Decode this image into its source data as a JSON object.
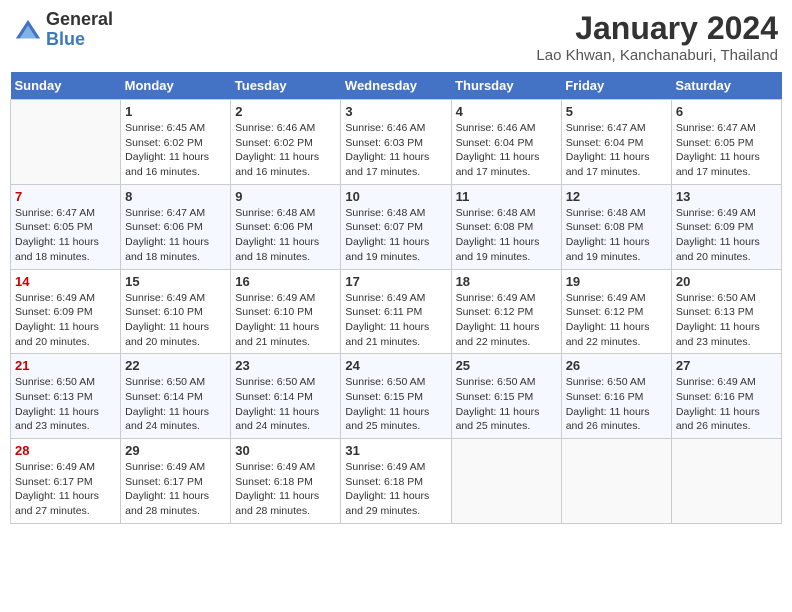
{
  "header": {
    "logo_general": "General",
    "logo_blue": "Blue",
    "month": "January 2024",
    "location": "Lao Khwan, Kanchanaburi, Thailand"
  },
  "days_of_week": [
    "Sunday",
    "Monday",
    "Tuesday",
    "Wednesday",
    "Thursday",
    "Friday",
    "Saturday"
  ],
  "weeks": [
    [
      {
        "day": "",
        "sunrise": "",
        "sunset": "",
        "daylight": ""
      },
      {
        "day": "1",
        "sunrise": "Sunrise: 6:45 AM",
        "sunset": "Sunset: 6:02 PM",
        "daylight": "Daylight: 11 hours and 16 minutes."
      },
      {
        "day": "2",
        "sunrise": "Sunrise: 6:46 AM",
        "sunset": "Sunset: 6:02 PM",
        "daylight": "Daylight: 11 hours and 16 minutes."
      },
      {
        "day": "3",
        "sunrise": "Sunrise: 6:46 AM",
        "sunset": "Sunset: 6:03 PM",
        "daylight": "Daylight: 11 hours and 17 minutes."
      },
      {
        "day": "4",
        "sunrise": "Sunrise: 6:46 AM",
        "sunset": "Sunset: 6:04 PM",
        "daylight": "Daylight: 11 hours and 17 minutes."
      },
      {
        "day": "5",
        "sunrise": "Sunrise: 6:47 AM",
        "sunset": "Sunset: 6:04 PM",
        "daylight": "Daylight: 11 hours and 17 minutes."
      },
      {
        "day": "6",
        "sunrise": "Sunrise: 6:47 AM",
        "sunset": "Sunset: 6:05 PM",
        "daylight": "Daylight: 11 hours and 17 minutes."
      }
    ],
    [
      {
        "day": "7",
        "sunrise": "Sunrise: 6:47 AM",
        "sunset": "Sunset: 6:05 PM",
        "daylight": "Daylight: 11 hours and 18 minutes."
      },
      {
        "day": "8",
        "sunrise": "Sunrise: 6:47 AM",
        "sunset": "Sunset: 6:06 PM",
        "daylight": "Daylight: 11 hours and 18 minutes."
      },
      {
        "day": "9",
        "sunrise": "Sunrise: 6:48 AM",
        "sunset": "Sunset: 6:06 PM",
        "daylight": "Daylight: 11 hours and 18 minutes."
      },
      {
        "day": "10",
        "sunrise": "Sunrise: 6:48 AM",
        "sunset": "Sunset: 6:07 PM",
        "daylight": "Daylight: 11 hours and 19 minutes."
      },
      {
        "day": "11",
        "sunrise": "Sunrise: 6:48 AM",
        "sunset": "Sunset: 6:08 PM",
        "daylight": "Daylight: 11 hours and 19 minutes."
      },
      {
        "day": "12",
        "sunrise": "Sunrise: 6:48 AM",
        "sunset": "Sunset: 6:08 PM",
        "daylight": "Daylight: 11 hours and 19 minutes."
      },
      {
        "day": "13",
        "sunrise": "Sunrise: 6:49 AM",
        "sunset": "Sunset: 6:09 PM",
        "daylight": "Daylight: 11 hours and 20 minutes."
      }
    ],
    [
      {
        "day": "14",
        "sunrise": "Sunrise: 6:49 AM",
        "sunset": "Sunset: 6:09 PM",
        "daylight": "Daylight: 11 hours and 20 minutes."
      },
      {
        "day": "15",
        "sunrise": "Sunrise: 6:49 AM",
        "sunset": "Sunset: 6:10 PM",
        "daylight": "Daylight: 11 hours and 20 minutes."
      },
      {
        "day": "16",
        "sunrise": "Sunrise: 6:49 AM",
        "sunset": "Sunset: 6:10 PM",
        "daylight": "Daylight: 11 hours and 21 minutes."
      },
      {
        "day": "17",
        "sunrise": "Sunrise: 6:49 AM",
        "sunset": "Sunset: 6:11 PM",
        "daylight": "Daylight: 11 hours and 21 minutes."
      },
      {
        "day": "18",
        "sunrise": "Sunrise: 6:49 AM",
        "sunset": "Sunset: 6:12 PM",
        "daylight": "Daylight: 11 hours and 22 minutes."
      },
      {
        "day": "19",
        "sunrise": "Sunrise: 6:49 AM",
        "sunset": "Sunset: 6:12 PM",
        "daylight": "Daylight: 11 hours and 22 minutes."
      },
      {
        "day": "20",
        "sunrise": "Sunrise: 6:50 AM",
        "sunset": "Sunset: 6:13 PM",
        "daylight": "Daylight: 11 hours and 23 minutes."
      }
    ],
    [
      {
        "day": "21",
        "sunrise": "Sunrise: 6:50 AM",
        "sunset": "Sunset: 6:13 PM",
        "daylight": "Daylight: 11 hours and 23 minutes."
      },
      {
        "day": "22",
        "sunrise": "Sunrise: 6:50 AM",
        "sunset": "Sunset: 6:14 PM",
        "daylight": "Daylight: 11 hours and 24 minutes."
      },
      {
        "day": "23",
        "sunrise": "Sunrise: 6:50 AM",
        "sunset": "Sunset: 6:14 PM",
        "daylight": "Daylight: 11 hours and 24 minutes."
      },
      {
        "day": "24",
        "sunrise": "Sunrise: 6:50 AM",
        "sunset": "Sunset: 6:15 PM",
        "daylight": "Daylight: 11 hours and 25 minutes."
      },
      {
        "day": "25",
        "sunrise": "Sunrise: 6:50 AM",
        "sunset": "Sunset: 6:15 PM",
        "daylight": "Daylight: 11 hours and 25 minutes."
      },
      {
        "day": "26",
        "sunrise": "Sunrise: 6:50 AM",
        "sunset": "Sunset: 6:16 PM",
        "daylight": "Daylight: 11 hours and 26 minutes."
      },
      {
        "day": "27",
        "sunrise": "Sunrise: 6:49 AM",
        "sunset": "Sunset: 6:16 PM",
        "daylight": "Daylight: 11 hours and 26 minutes."
      }
    ],
    [
      {
        "day": "28",
        "sunrise": "Sunrise: 6:49 AM",
        "sunset": "Sunset: 6:17 PM",
        "daylight": "Daylight: 11 hours and 27 minutes."
      },
      {
        "day": "29",
        "sunrise": "Sunrise: 6:49 AM",
        "sunset": "Sunset: 6:17 PM",
        "daylight": "Daylight: 11 hours and 28 minutes."
      },
      {
        "day": "30",
        "sunrise": "Sunrise: 6:49 AM",
        "sunset": "Sunset: 6:18 PM",
        "daylight": "Daylight: 11 hours and 28 minutes."
      },
      {
        "day": "31",
        "sunrise": "Sunrise: 6:49 AM",
        "sunset": "Sunset: 6:18 PM",
        "daylight": "Daylight: 11 hours and 29 minutes."
      },
      {
        "day": "",
        "sunrise": "",
        "sunset": "",
        "daylight": ""
      },
      {
        "day": "",
        "sunrise": "",
        "sunset": "",
        "daylight": ""
      },
      {
        "day": "",
        "sunrise": "",
        "sunset": "",
        "daylight": ""
      }
    ]
  ]
}
